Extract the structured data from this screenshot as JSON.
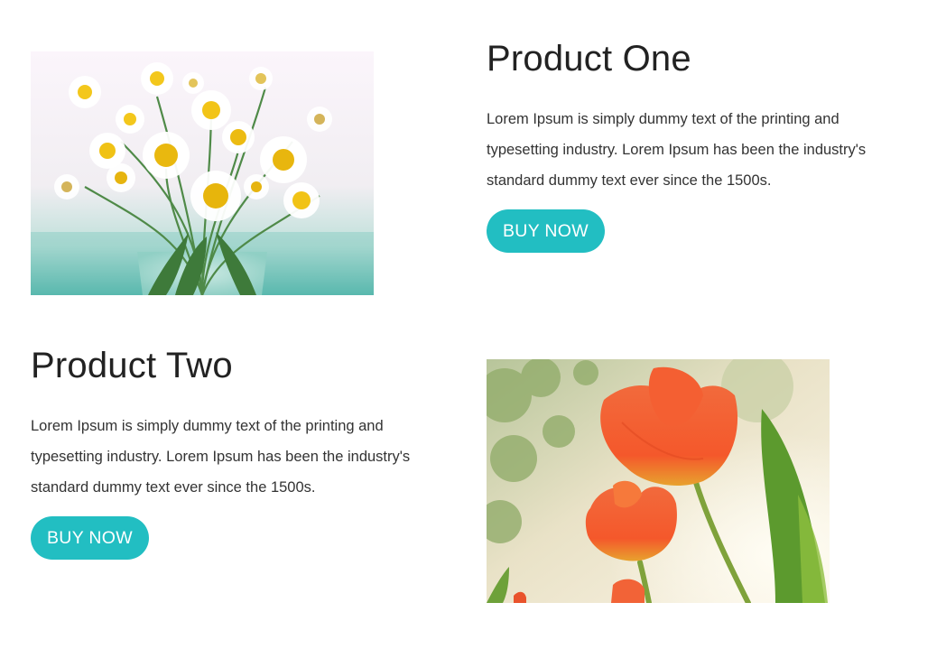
{
  "products": [
    {
      "title": "Product One",
      "description": "Lorem Ipsum is simply dummy text of the printing and typesetting industry. Lorem Ipsum has been the industry's standard dummy text ever since the 1500s.",
      "button_label": "BUY NOW",
      "image_icon": "daisy-bouquet-photo"
    },
    {
      "title": "Product Two",
      "description": "Lorem Ipsum is simply dummy text of the printing and typesetting industry. Lorem Ipsum has been the industry's standard dummy text ever since the 1500s.",
      "button_label": "BUY NOW",
      "image_icon": "red-tulips-photo"
    }
  ],
  "colors": {
    "accent": "#22bec2",
    "text": "#333333",
    "heading": "#222222",
    "background": "#ffffff"
  }
}
